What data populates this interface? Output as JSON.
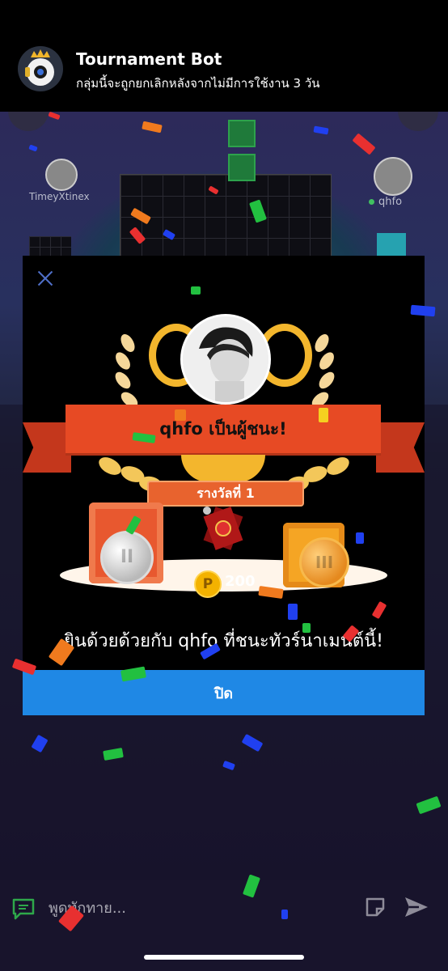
{
  "header": {
    "bot_name": "Tournament Bot",
    "subtitle": "กลุ่มนี้จะถูกยกเลิกหลังจากไม่มีการใช้งาน 3 วัน"
  },
  "background": {
    "player_left_name": "TimeyXtinex",
    "player_right_name": "qhfo"
  },
  "modal": {
    "winner_banner": "qhfo เป็นผู้ชนะ!",
    "rank_label": "รางวัลที่ 1",
    "coin_symbol": "P",
    "coin_amount": "200",
    "congrats_text": "ยินด้วยด้วยกับ qhfo ที่ชนะทัวร์นาเมนต์นี้!",
    "close_button": "ปิด"
  },
  "chat": {
    "placeholder": "พูดทักทาย..."
  },
  "colors": {
    "modal_bg": "#000000",
    "ribbon": "#e74a24",
    "close_button": "#1f88e5",
    "gold": "#f3b62d"
  }
}
